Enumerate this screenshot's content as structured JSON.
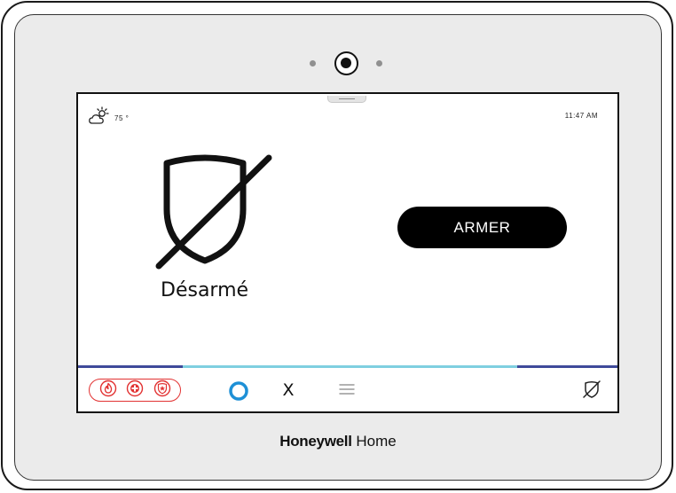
{
  "device": {
    "brand_bold": "Honeywell",
    "brand_light": "Home"
  },
  "status_bar": {
    "weather_icon": "partly-cloudy-icon",
    "temperature": "75 °",
    "time": "11:47 AM"
  },
  "main": {
    "status_icon": "shield-disarmed-icon",
    "status_label": "Désarmé",
    "arm_button_label": "ARMER"
  },
  "bottom_bar": {
    "emergency_icons": [
      "fire-icon",
      "medical-icon",
      "police-icon"
    ],
    "alexa_icon": "alexa-ring-icon",
    "close_label": "X",
    "menu_icon": "hamburger-menu-icon",
    "security_icon": "shield-slash-icon"
  },
  "colors": {
    "emergency": "#e23232",
    "alexa": "#1e90d6",
    "divider": "#3f4a9a",
    "divider_highlight": "#7fcfe0"
  }
}
